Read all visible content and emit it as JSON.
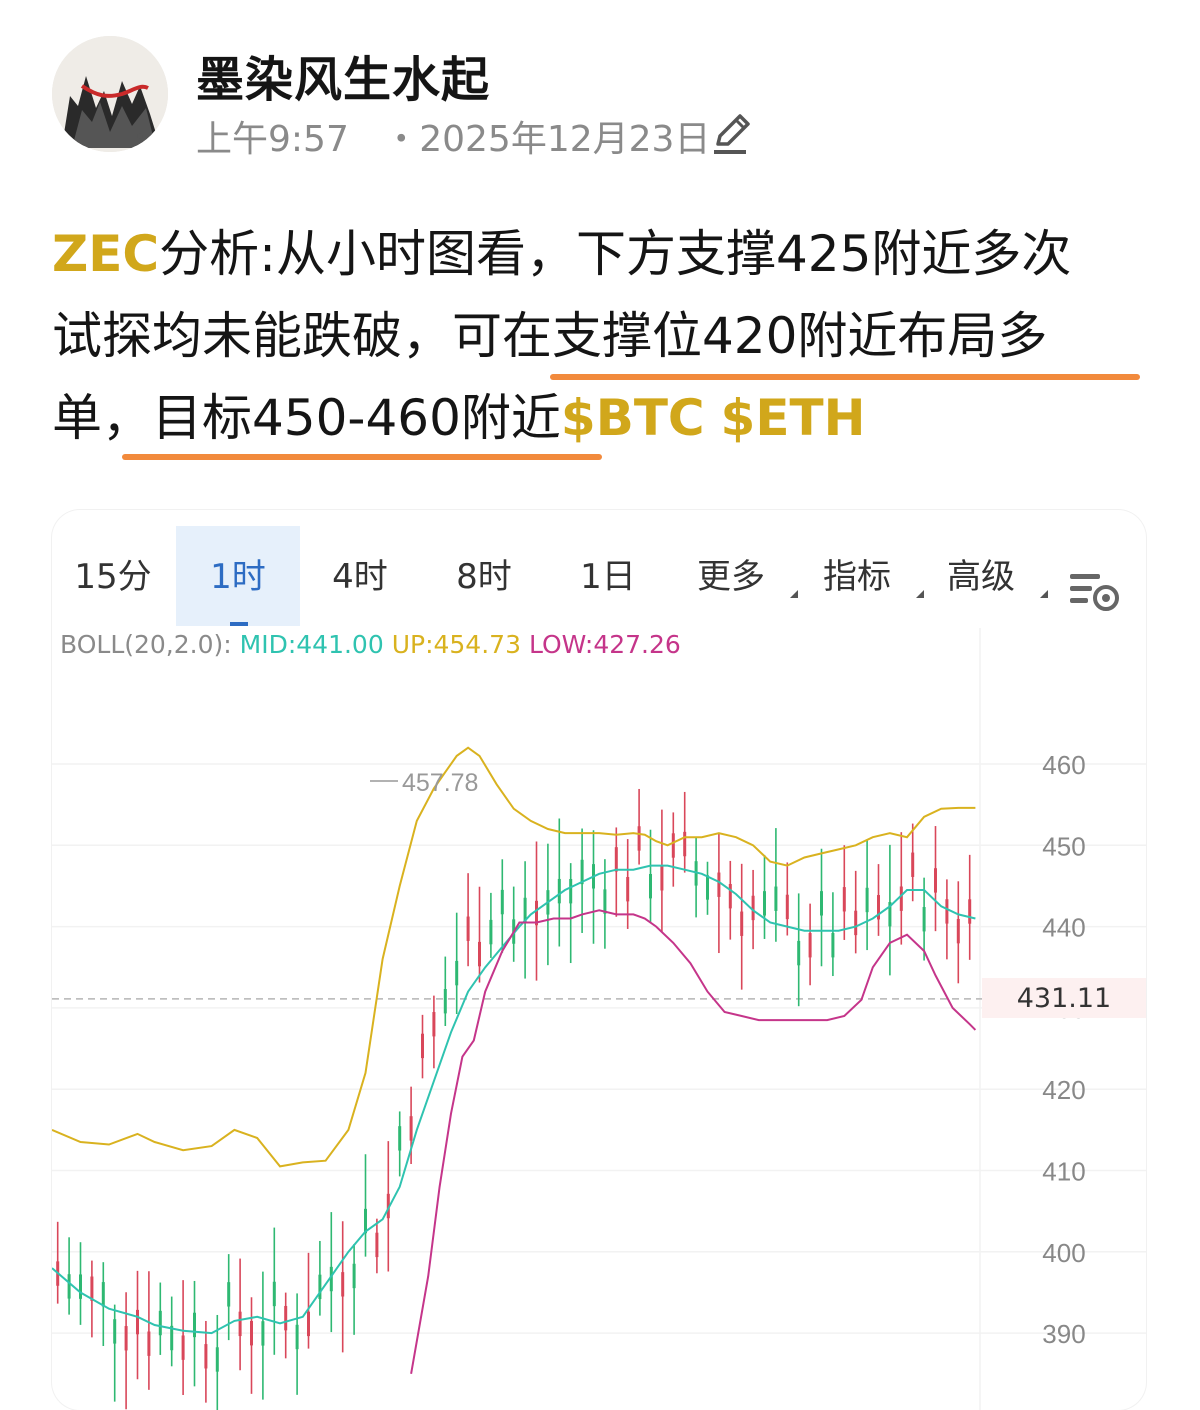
{
  "author": {
    "name": "墨染风生水起",
    "time": "上午9:57",
    "date": "・2025年12月23日",
    "avatar_icon": "ink-landscape-avatar",
    "edit_icon": "pencil-icon"
  },
  "post": {
    "line1": {
      "tag": "ZEC",
      "text": "分析:从小时图看，下方支撑425附近多次"
    },
    "line2": {
      "text": "试探均未能跌破，可在支撑位420附近布局多"
    },
    "line3": {
      "text": "单，目标450-460附近",
      "tag1": "$BTC",
      "tag2": "$ETH"
    },
    "underline_color": "#f28a3c",
    "tag_color": "#d1a71b"
  },
  "chart_tabs": [
    {
      "label": "15分",
      "active": false
    },
    {
      "label": "1时",
      "active": true
    },
    {
      "label": "4时",
      "active": false
    },
    {
      "label": "8时",
      "active": false
    },
    {
      "label": "1日",
      "active": false
    },
    {
      "label": "更多",
      "active": false,
      "dropdown": true
    },
    {
      "label": "指标",
      "active": false,
      "dropdown": true
    },
    {
      "label": "高级",
      "active": false,
      "dropdown": true
    }
  ],
  "chart_settings_icon": "chart-settings-icon",
  "boll": {
    "label": "BOLL(20,2.0):",
    "mid": "MID:441.00",
    "up": "UP:454.73",
    "low": "LOW:427.26",
    "colors": {
      "mid": "#2fc3b0",
      "up": "#d9b21f",
      "low": "#c5358a",
      "label": "#8a8a8a"
    }
  },
  "chart_data": {
    "type": "line",
    "title": "",
    "ylim": [
      386,
      465
    ],
    "y_ticks": [
      "460",
      "450",
      "440",
      "430",
      "420",
      "410",
      "400",
      "390"
    ],
    "current_price": "431.11",
    "max_annotation": "457.78",
    "series": [
      {
        "name": "UP",
        "color": "#d9b21f",
        "values": [
          [
            0,
            415
          ],
          [
            5,
            413.5
          ],
          [
            10,
            413.2
          ],
          [
            15,
            414.5
          ],
          [
            18,
            413.5
          ],
          [
            23,
            412.5
          ],
          [
            28,
            413
          ],
          [
            32,
            415
          ],
          [
            36,
            414
          ],
          [
            40,
            410.5
          ],
          [
            44,
            411
          ],
          [
            48,
            411.2
          ],
          [
            52,
            415
          ],
          [
            55,
            422
          ],
          [
            58,
            436
          ],
          [
            61,
            445
          ],
          [
            64,
            453
          ],
          [
            67,
            457
          ],
          [
            69,
            459
          ],
          [
            71,
            461
          ],
          [
            73,
            462
          ],
          [
            75,
            461
          ],
          [
            78,
            457.5
          ],
          [
            81,
            454.5
          ],
          [
            84,
            453
          ],
          [
            87,
            452
          ],
          [
            90,
            451.5
          ],
          [
            93,
            451.5
          ],
          [
            96,
            451.5
          ],
          [
            99,
            451.3
          ],
          [
            102,
            451.5
          ],
          [
            104,
            451.3
          ],
          [
            106,
            450.5
          ],
          [
            108,
            450
          ],
          [
            111,
            451
          ],
          [
            114,
            451
          ],
          [
            117,
            451.5
          ],
          [
            120,
            451
          ],
          [
            123,
            450
          ],
          [
            126,
            448
          ],
          [
            129,
            447.5
          ],
          [
            132,
            448.5
          ],
          [
            135,
            449
          ],
          [
            138,
            449.5
          ],
          [
            141,
            450
          ],
          [
            144,
            451
          ],
          [
            147,
            451.5
          ],
          [
            150,
            451
          ],
          [
            153,
            453.5
          ],
          [
            156,
            454.5
          ],
          [
            159,
            454.6
          ],
          [
            162,
            454.6
          ]
        ]
      },
      {
        "name": "MID",
        "color": "#2fc3b0",
        "values": [
          [
            0,
            398
          ],
          [
            5,
            395
          ],
          [
            10,
            393
          ],
          [
            15,
            392
          ],
          [
            18,
            391
          ],
          [
            23,
            390.3
          ],
          [
            28,
            390
          ],
          [
            32,
            391.5
          ],
          [
            36,
            392
          ],
          [
            40,
            391.2
          ],
          [
            44,
            392
          ],
          [
            48,
            396
          ],
          [
            52,
            400
          ],
          [
            55,
            402.5
          ],
          [
            58,
            404
          ],
          [
            61,
            408
          ],
          [
            64,
            415
          ],
          [
            67,
            421
          ],
          [
            70,
            427
          ],
          [
            73,
            432
          ],
          [
            76,
            435
          ],
          [
            79,
            437.5
          ],
          [
            82,
            440
          ],
          [
            84,
            441.5
          ],
          [
            87,
            443
          ],
          [
            90,
            444.5
          ],
          [
            93,
            445.5
          ],
          [
            96,
            446.5
          ],
          [
            99,
            447
          ],
          [
            102,
            447
          ],
          [
            105,
            447.5
          ],
          [
            108,
            447.5
          ],
          [
            111,
            447
          ],
          [
            114,
            446.5
          ],
          [
            117,
            445.5
          ],
          [
            120,
            444
          ],
          [
            123,
            442
          ],
          [
            126,
            440.5
          ],
          [
            129,
            440
          ],
          [
            132,
            439.5
          ],
          [
            135,
            439.5
          ],
          [
            138,
            439.5
          ],
          [
            141,
            440
          ],
          [
            144,
            441
          ],
          [
            147,
            442.5
          ],
          [
            150,
            444.5
          ],
          [
            153,
            444.5
          ],
          [
            156,
            442.5
          ],
          [
            159,
            441.5
          ],
          [
            162,
            441
          ]
        ]
      },
      {
        "name": "LOW",
        "color": "#c5358a",
        "values": [
          [
            63,
            385
          ],
          [
            66,
            397
          ],
          [
            68,
            408
          ],
          [
            70,
            417
          ],
          [
            72,
            424
          ],
          [
            74,
            426
          ],
          [
            76,
            432
          ],
          [
            79,
            437
          ],
          [
            82,
            440.5
          ],
          [
            85,
            440.5
          ],
          [
            88,
            441
          ],
          [
            91,
            441
          ],
          [
            93,
            441.5
          ],
          [
            96,
            442
          ],
          [
            99,
            441.5
          ],
          [
            102,
            441.5
          ],
          [
            104,
            441
          ],
          [
            106,
            440
          ],
          [
            109,
            438
          ],
          [
            112,
            435.5
          ],
          [
            115,
            432
          ],
          [
            118,
            429.5
          ],
          [
            121,
            429
          ],
          [
            124,
            428.5
          ],
          [
            127,
            428.5
          ],
          [
            130,
            428.5
          ],
          [
            133,
            428.5
          ],
          [
            136,
            428.5
          ],
          [
            139,
            429
          ],
          [
            142,
            431
          ],
          [
            144,
            435
          ],
          [
            147,
            438
          ],
          [
            150,
            439
          ],
          [
            153,
            437
          ],
          [
            155,
            434
          ],
          [
            158,
            430
          ],
          [
            161,
            428
          ],
          [
            162,
            427.3
          ]
        ]
      }
    ]
  }
}
